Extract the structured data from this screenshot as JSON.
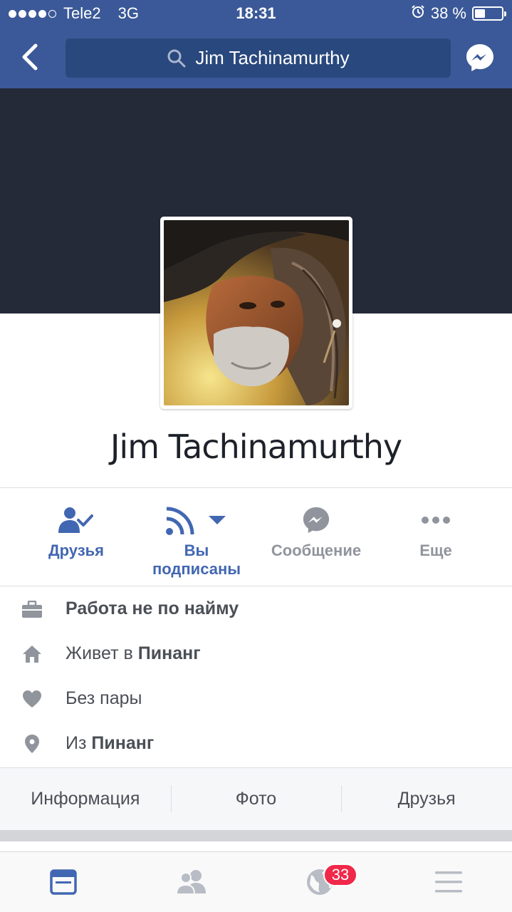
{
  "status_bar": {
    "carrier": "Tele2",
    "network": "3G",
    "time": "18:31",
    "battery": "38 %",
    "battery_level": 0.38,
    "signal_bars_filled": 4,
    "signal_bars_total": 5
  },
  "nav": {
    "search_text": "Jim Tachinamurthy",
    "icons": [
      "back-chevron",
      "search",
      "messenger"
    ]
  },
  "profile": {
    "name": "Jim Tachinamurthy"
  },
  "actions": [
    {
      "label": "Друзья",
      "icon": "friends-check",
      "color": "#4267b2"
    },
    {
      "label_line1": "Вы",
      "label_line2": "подписаны",
      "icon": "rss-follow",
      "color": "#4267b2"
    },
    {
      "label": "Сообщение",
      "icon": "messenger",
      "color": "#90949c"
    },
    {
      "label": "Еще",
      "icon": "more-dots",
      "color": "#90949c"
    }
  ],
  "info": {
    "work": "Работа не по найму",
    "lives_prefix": "Живет в ",
    "lives_place": "Пинанг",
    "relationship": "Без пары",
    "from_prefix": "Из ",
    "from_place": "Пинанг"
  },
  "tabs": [
    "Информация",
    "Фото",
    "Друзья"
  ],
  "tab_bar": {
    "notifications_badge": "33",
    "items": [
      "news-feed",
      "friend-requests",
      "notifications-globe",
      "menu"
    ]
  },
  "colors": {
    "brand": "#3b5998",
    "search_bg": "#29487d",
    "cover": "#242a38",
    "action_blue": "#4267b2",
    "action_gray": "#90949c",
    "badge": "#f02849"
  }
}
